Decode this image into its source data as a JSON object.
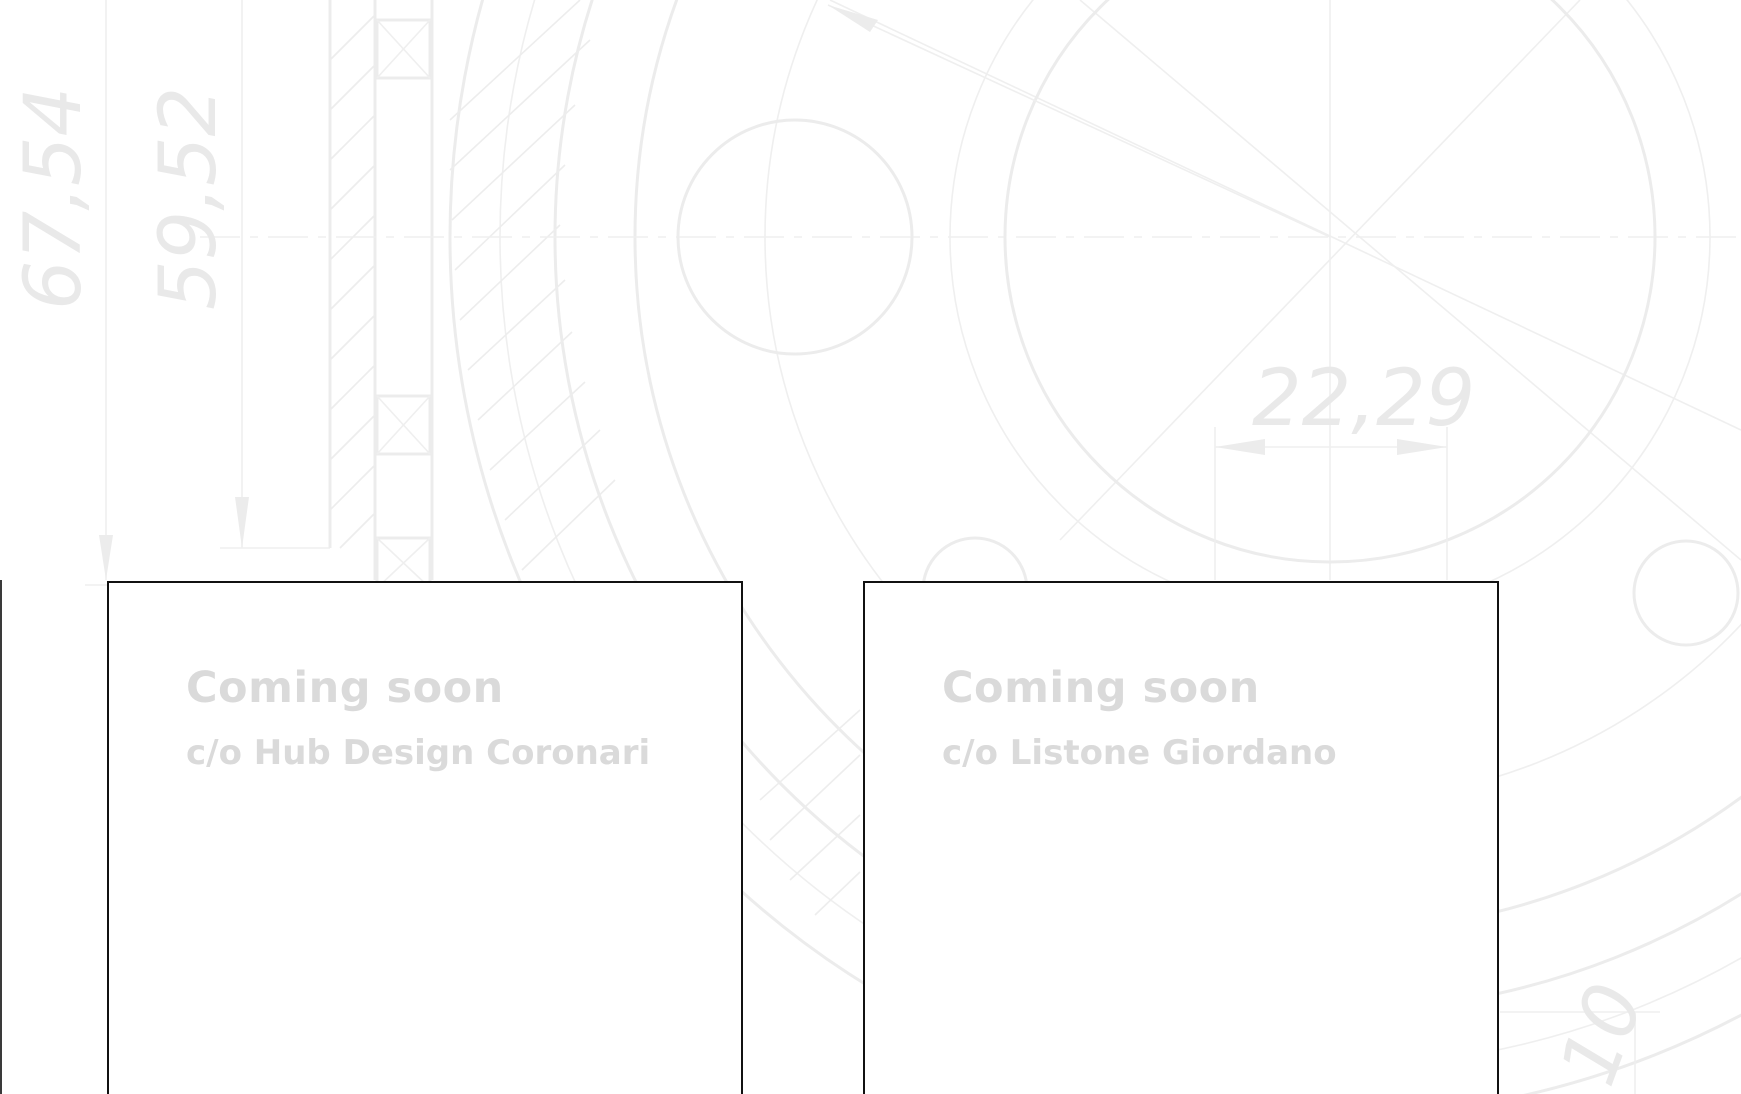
{
  "background": {
    "dimension_labels": [
      "67,54",
      "59,52",
      "22,29",
      "10"
    ],
    "line_color": "#ececec"
  },
  "cards": [
    {
      "title": "Coming soon",
      "subtitle": "c/o Hub Design Coronari"
    },
    {
      "title": "Coming soon",
      "subtitle": "c/o Listone Giordano"
    }
  ],
  "colors": {
    "card_border": "#111111",
    "card_text": "#dadada",
    "page_background": "#ffffff"
  }
}
